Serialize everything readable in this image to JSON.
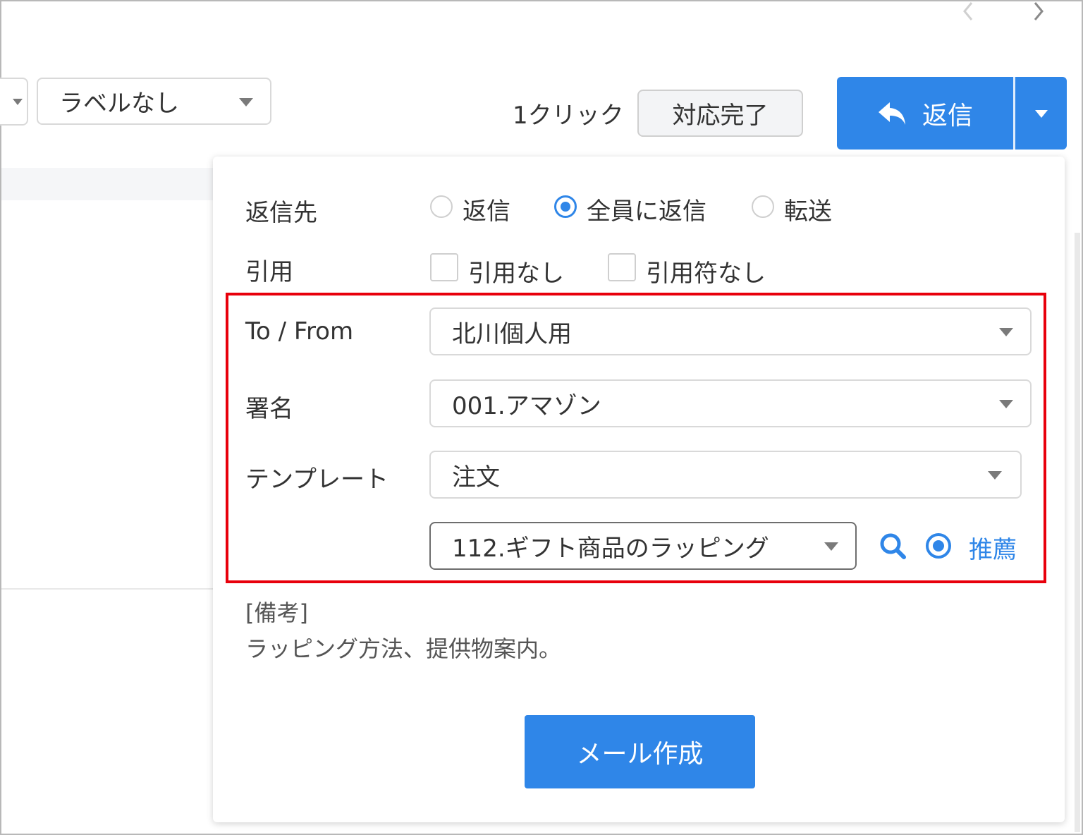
{
  "toolbar": {
    "label_filter_value": "ラベルなし",
    "one_click_text": "1クリック",
    "done_button_label": "対応完了",
    "reply_button_label": "返信"
  },
  "panel": {
    "reply_to": {
      "label": "返信先",
      "options": [
        "返信",
        "全員に返信",
        "転送"
      ],
      "selected": "全員に返信"
    },
    "quote": {
      "label": "引用",
      "options": [
        "引用なし",
        "引用符なし"
      ],
      "checked": [
        false,
        false
      ]
    },
    "to_from": {
      "label": "To / From",
      "value": "北川個人用"
    },
    "signature": {
      "label": "署名",
      "value": "001.アマゾン"
    },
    "template": {
      "label": "テンプレート",
      "category_value": "注文",
      "item_value": "112.ギフト商品のラッピング",
      "recommend_label": "推薦"
    },
    "note": {
      "heading": "[備考]",
      "body": "ラッピング方法、提供物案内。"
    },
    "compose_button_label": "メール作成"
  },
  "colors": {
    "accent": "#2f86e8",
    "highlight_border": "#e8000b",
    "border": "#d9d9d9",
    "text": "#333333"
  },
  "icons": [
    "chevron-left-icon",
    "chevron-right-icon",
    "reply-icon",
    "caret-down-icon",
    "search-icon",
    "eye-icon"
  ]
}
